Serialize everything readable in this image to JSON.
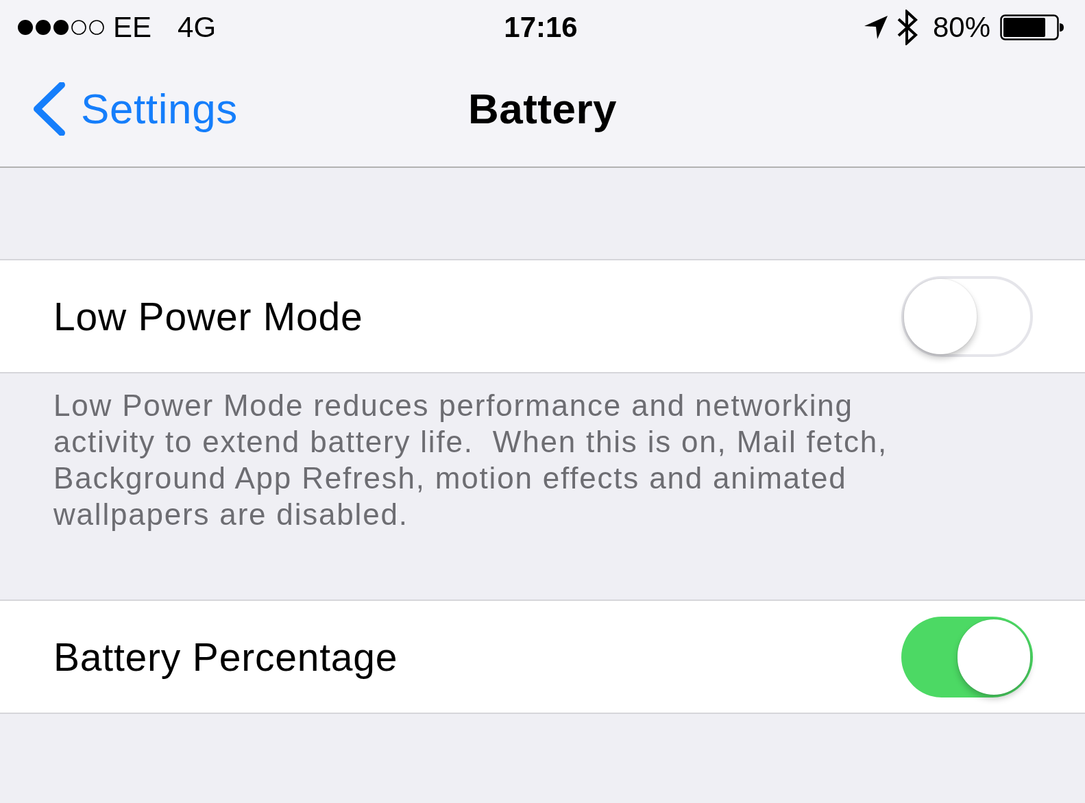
{
  "status_bar": {
    "carrier": "EE",
    "network": "4G",
    "time": "17:16",
    "battery": "80%"
  },
  "nav_bar": {
    "back": "Settings",
    "title": "Battery"
  },
  "settings": [
    {
      "label": "Low Power Mode",
      "on": false,
      "footer": "Low Power Mode reduces performance and networking activity to extend battery life.  When this is on, Mail fetch, Background App Refresh, motion effects and animated wallpapers are disabled."
    },
    {
      "label": "Battery Percentage",
      "on": true
    }
  ]
}
